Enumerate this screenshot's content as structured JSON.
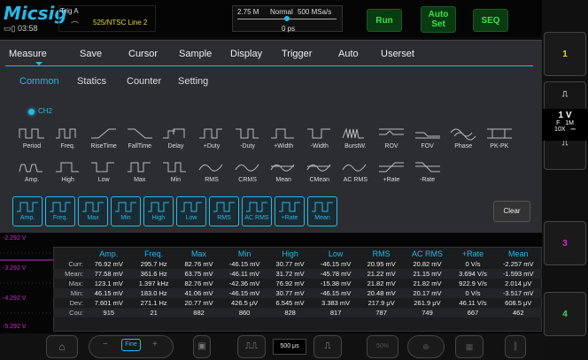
{
  "status": {
    "logo": "Micsig",
    "clock": "03:58",
    "trig_label": "Trig",
    "trig_source": "A",
    "trig_value": "525/NTSC Line 2",
    "memory": "2.75 M",
    "mode": "Normal",
    "sample_rate": "500 MSa/s",
    "position": "0 ps"
  },
  "buttons": {
    "run": "Run",
    "auto_set_1": "Auto",
    "auto_set_2": "Set",
    "seq": "SEQ"
  },
  "menu_tabs": [
    "Measure",
    "Save",
    "Cursor",
    "Sample",
    "Display",
    "Trigger",
    "Auto",
    "Userset"
  ],
  "sub_tabs": [
    "Common",
    "Statics",
    "Counter",
    "Setting"
  ],
  "channel": "CH2",
  "row1": [
    "Period",
    "Freq.",
    "RiseTime",
    "FallTime",
    "Delay",
    "+Duty",
    "-Duty",
    "+Width",
    "-Width",
    "BurstW.",
    "ROV",
    "FOV",
    "Phase",
    "PK-PK"
  ],
  "row2": [
    "Amp.",
    "High",
    "Low",
    "Max",
    "Min",
    "RMS",
    "CRMS",
    "Mean",
    "CMean",
    "AC RMS",
    "+Rate",
    "-Rate"
  ],
  "selected": [
    "Amp.",
    "Freq.",
    "Max",
    "Min",
    "High",
    "Low",
    "RMS",
    "AC RMS",
    "+Rate",
    "Mean"
  ],
  "clear_label": "Clear",
  "right": {
    "btn1": "1",
    "btn3": "3",
    "btn4": "4",
    "volts": "1 V",
    "f": "F",
    "m": "1M",
    "probe": "10X"
  },
  "y_labels": [
    "-2.292 V",
    "-3.292 V",
    "-4.292 V",
    "-5.292 V"
  ],
  "table": {
    "headers": [
      "Amp.",
      "Freq.",
      "Max",
      "Min",
      "High",
      "Low",
      "RMS",
      "AC RMS",
      "+Rate",
      "Mean"
    ],
    "rows": [
      {
        "label": "Curr:",
        "values": [
          "76.92 mV",
          "295.7 Hz",
          "82.76 mV",
          "-46.15 mV",
          "30.77 mV",
          "-46.15 mV",
          "20.95 mV",
          "20.82 mV",
          "0 V/s",
          "-2.257 mV"
        ]
      },
      {
        "label": "Mean:",
        "values": [
          "77.58 mV",
          "361.6 Hz",
          "63.75 mV",
          "-46.11 mV",
          "31.72 mV",
          "-45.78 mV",
          "21.22 mV",
          "21.15 mV",
          "3.694 V/s",
          "-1.593 mV"
        ]
      },
      {
        "label": "Max:",
        "values": [
          "123.1 mV",
          "1.397 kHz",
          "82.76 mV",
          "-42.36 mV",
          "76.92 mV",
          "-15.38 mV",
          "21.82 mV",
          "21.82 mV",
          "922.9 V/s",
          "2.014 μV"
        ]
      },
      {
        "label": "Min:",
        "values": [
          "46.15 mV",
          "183.0 Hz",
          "41.06 mV",
          "-46.15 mV",
          "30.77 mV",
          "-46.15 mV",
          "20.48 mV",
          "20.17 mV",
          "0 V/s",
          "-3.517 mV"
        ]
      },
      {
        "label": "Dev:",
        "values": [
          "7.601 mV",
          "271.1 Hz",
          "20.77 mV",
          "426.5 μV",
          "6.545 mV",
          "3.383 mV",
          "217.9 μV",
          "261.9 μV",
          "46.11 V/s",
          "608.5 μV"
        ]
      },
      {
        "label": "Cou:",
        "values": [
          "915",
          "21",
          "882",
          "860",
          "828",
          "817",
          "787",
          "749",
          "667",
          "462"
        ]
      }
    ]
  },
  "bottom": {
    "fine": "Fine",
    "timebase": "500 μs",
    "zoom": "50%"
  }
}
